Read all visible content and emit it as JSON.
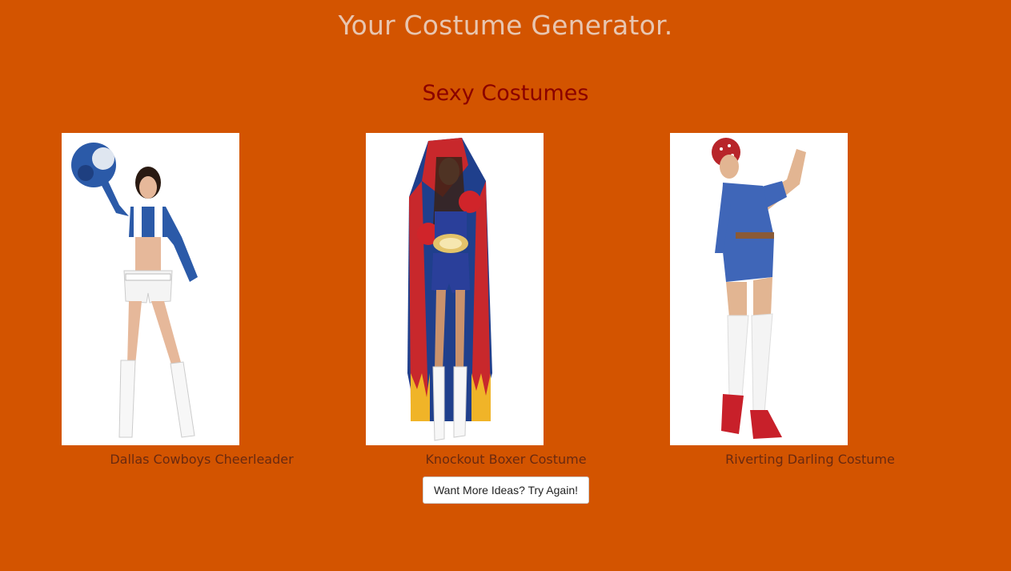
{
  "site": {
    "title": "Your Costume Generator."
  },
  "category": {
    "heading": "Sexy Costumes"
  },
  "costumes": [
    {
      "name": "Dallas Cowboys Cheerleader",
      "image_alt": "Dallas Cowboys Cheerleader"
    },
    {
      "name": "Knockout Boxer Costume",
      "image_alt": "Knockout Boxer Costume"
    },
    {
      "name": "Riverting Darling Costume",
      "image_alt": "Riverting Darling Costume"
    }
  ],
  "actions": {
    "try_again_label": "Want More Ideas? Try Again!"
  },
  "colors": {
    "background": "#d35400",
    "title": "#e8c6b0",
    "heading": "#8b0000",
    "caption": "#6a2a10"
  }
}
